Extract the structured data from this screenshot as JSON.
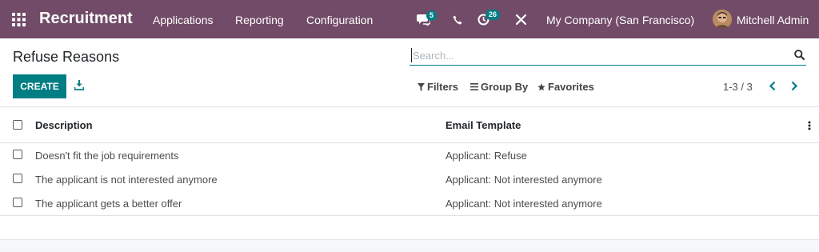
{
  "navbar": {
    "brand": "Recruitment",
    "menu": [
      "Applications",
      "Reporting",
      "Configuration"
    ],
    "messages_badge": "5",
    "activities_badge": "26",
    "company": "My Company (San Francisco)",
    "user": "Mitchell Admin",
    "colors": {
      "background": "#714B67",
      "badge": "#017e84"
    }
  },
  "control_panel": {
    "title": "Refuse Reasons",
    "search_placeholder": "Search...",
    "create_label": "CREATE",
    "filters_label": "Filters",
    "groupby_label": "Group By",
    "favorites_label": "Favorites",
    "pager": "1-3 / 3"
  },
  "table": {
    "columns": [
      "Description",
      "Email Template"
    ],
    "rows": [
      {
        "description": "Doesn't fit the job requirements",
        "template": "Applicant: Refuse"
      },
      {
        "description": "The applicant is not interested anymore",
        "template": "Applicant: Not interested anymore"
      },
      {
        "description": "The applicant gets a better offer",
        "template": "Applicant: Not interested anymore"
      }
    ]
  },
  "colors": {
    "primary": "#017e84"
  }
}
